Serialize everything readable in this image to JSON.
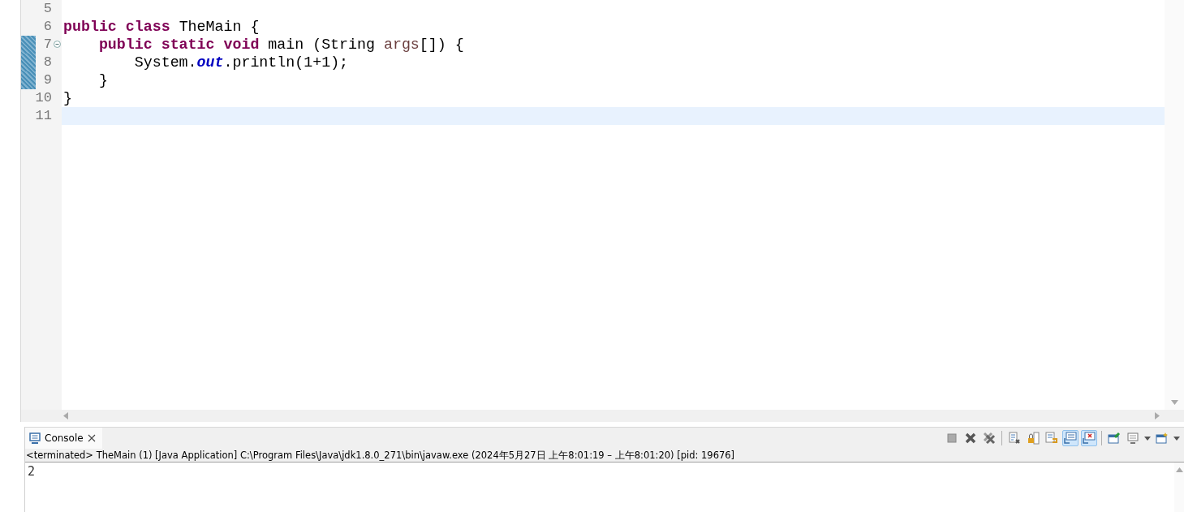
{
  "editor": {
    "lines": [
      {
        "number": "5",
        "changed": false,
        "current": false,
        "foldable": false
      },
      {
        "number": "6",
        "changed": false,
        "current": false,
        "foldable": false,
        "tokens": [
          {
            "text": "public class",
            "kind": "keyword"
          },
          {
            "text": " TheMain {",
            "kind": "plain"
          }
        ]
      },
      {
        "number": "7",
        "changed": true,
        "current": false,
        "foldable": true,
        "tokens": [
          {
            "text": "    public static void",
            "kind": "keyword"
          },
          {
            "text": " main (String ",
            "kind": "plain"
          },
          {
            "text": "args",
            "kind": "variable"
          },
          {
            "text": "[]) {",
            "kind": "plain"
          }
        ]
      },
      {
        "number": "8",
        "changed": true,
        "current": false,
        "foldable": false,
        "tokens": [
          {
            "text": "        System.",
            "kind": "plain"
          },
          {
            "text": "out",
            "kind": "field"
          },
          {
            "text": ".println(1+1);",
            "kind": "plain"
          }
        ]
      },
      {
        "number": "9",
        "changed": true,
        "current": false,
        "foldable": false,
        "tokens": [
          {
            "text": "    }",
            "kind": "plain"
          }
        ]
      },
      {
        "number": "10",
        "changed": false,
        "current": false,
        "foldable": false,
        "tokens": [
          {
            "text": "}",
            "kind": "plain"
          }
        ]
      },
      {
        "number": "11",
        "changed": false,
        "current": true,
        "foldable": false
      }
    ]
  },
  "console": {
    "tab": {
      "label": "Console",
      "selected": true
    },
    "toolbar": [
      {
        "kind": "stop",
        "on": false
      },
      {
        "kind": "remove",
        "on": false
      },
      {
        "kind": "remove-all",
        "on": false
      },
      {
        "kind": "separator"
      },
      {
        "kind": "clear",
        "on": false
      },
      {
        "kind": "scroll-lock",
        "on": false
      },
      {
        "kind": "word-wrap",
        "on": false
      },
      {
        "kind": "show-out",
        "on": true
      },
      {
        "kind": "show-err",
        "on": true
      },
      {
        "kind": "separator"
      },
      {
        "kind": "pin",
        "on": false
      },
      {
        "kind": "display",
        "on": false
      },
      {
        "kind": "dropdown"
      },
      {
        "kind": "new-console",
        "on": false
      },
      {
        "kind": "dropdown"
      }
    ],
    "status": "<terminated> TheMain (1) [Java Application] C:\\Program Files\\Java\\jdk1.8.0_271\\bin\\javaw.exe  (2024年5月27日 上午8:01:19 – 上午8:01:20) [pid: 19676]",
    "output": [
      "2"
    ]
  }
}
